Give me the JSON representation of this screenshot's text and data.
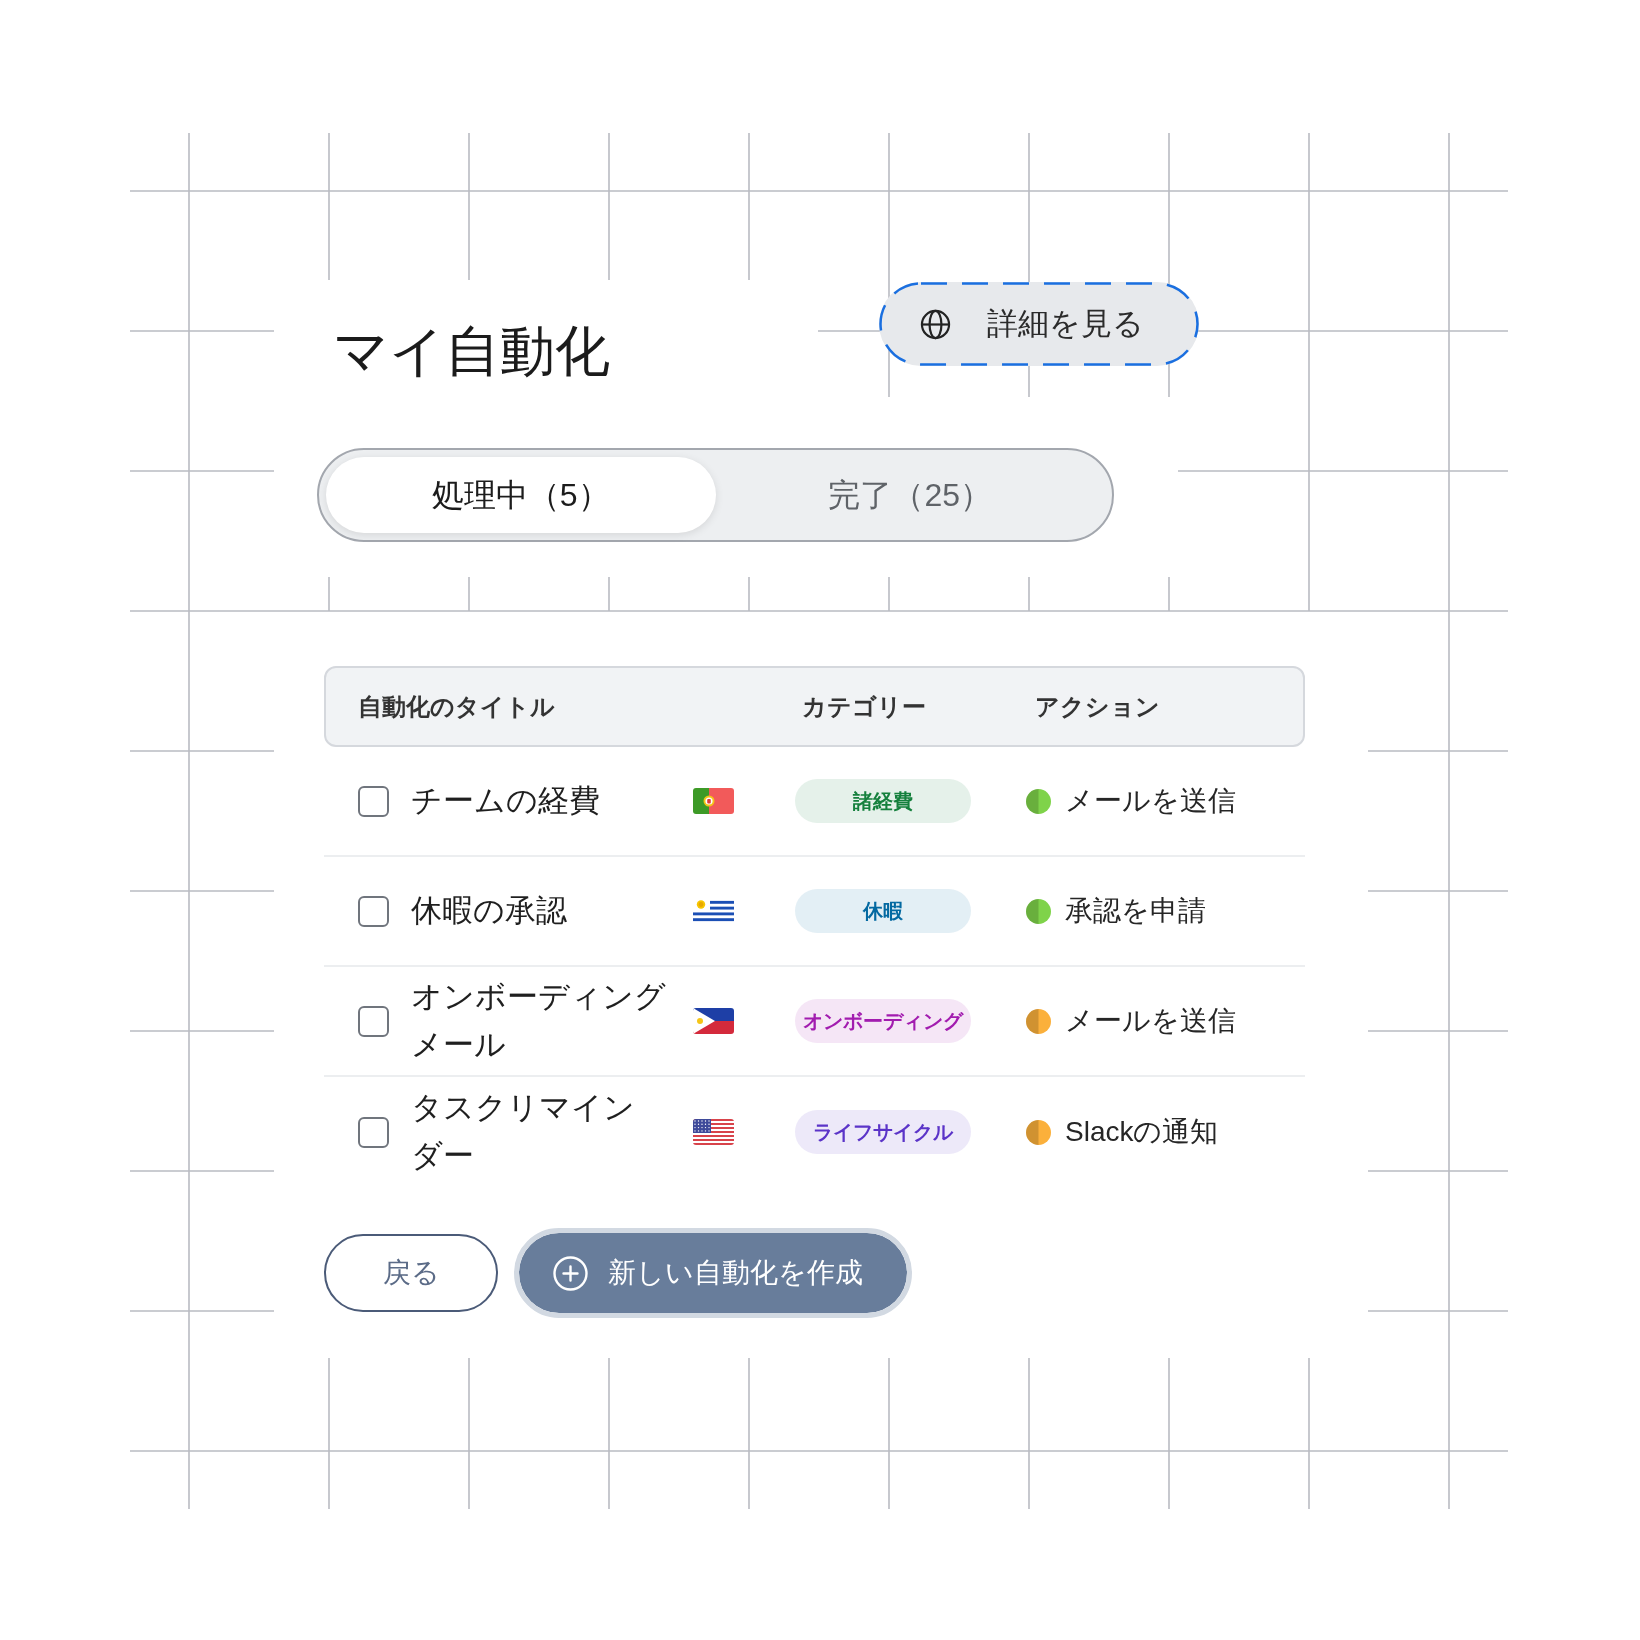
{
  "header": {
    "title": "マイ自動化",
    "details_button": {
      "label": "詳細を見る"
    }
  },
  "tabs": [
    {
      "label": "処理中（5）",
      "selected": true
    },
    {
      "label": "完了（25）",
      "selected": false
    }
  ],
  "table": {
    "columns": [
      "自動化のタイトル",
      "カテゴリー",
      "アクション"
    ],
    "rows": [
      {
        "checked": false,
        "title": "チームの経費",
        "flag": {
          "kind": "portugal"
        },
        "category": {
          "label": "諸経費",
          "color": "#15803d"
        },
        "action": {
          "label": "メールを送信",
          "color": "#7fd34a"
        }
      },
      {
        "checked": false,
        "title": "休暇の承認",
        "flag": {
          "kind": "uruguay"
        },
        "category": {
          "label": "休暇",
          "color": "#0369a1"
        },
        "action": {
          "label": "承認を申請",
          "color": "#7fd34a"
        }
      },
      {
        "checked": false,
        "title": "オンボーディングメール",
        "flag": {
          "kind": "philippines"
        },
        "category": {
          "label": "オンボーディング",
          "color": "#a21caf"
        },
        "action": {
          "label": "メールを送信",
          "color": "#fbb03b"
        }
      },
      {
        "checked": false,
        "title": "タスクリマインダー",
        "flag": {
          "kind": "usa"
        },
        "category": {
          "label": "ライフサイクル",
          "color": "#5b34c8"
        },
        "action": {
          "label": "Slackの通知",
          "color": "#fbb03b"
        }
      }
    ]
  },
  "footer_buttons": [
    {
      "label": "戻る",
      "kind": "outline"
    },
    {
      "label": "新しい自動化を作成",
      "kind": "primary"
    }
  ]
}
